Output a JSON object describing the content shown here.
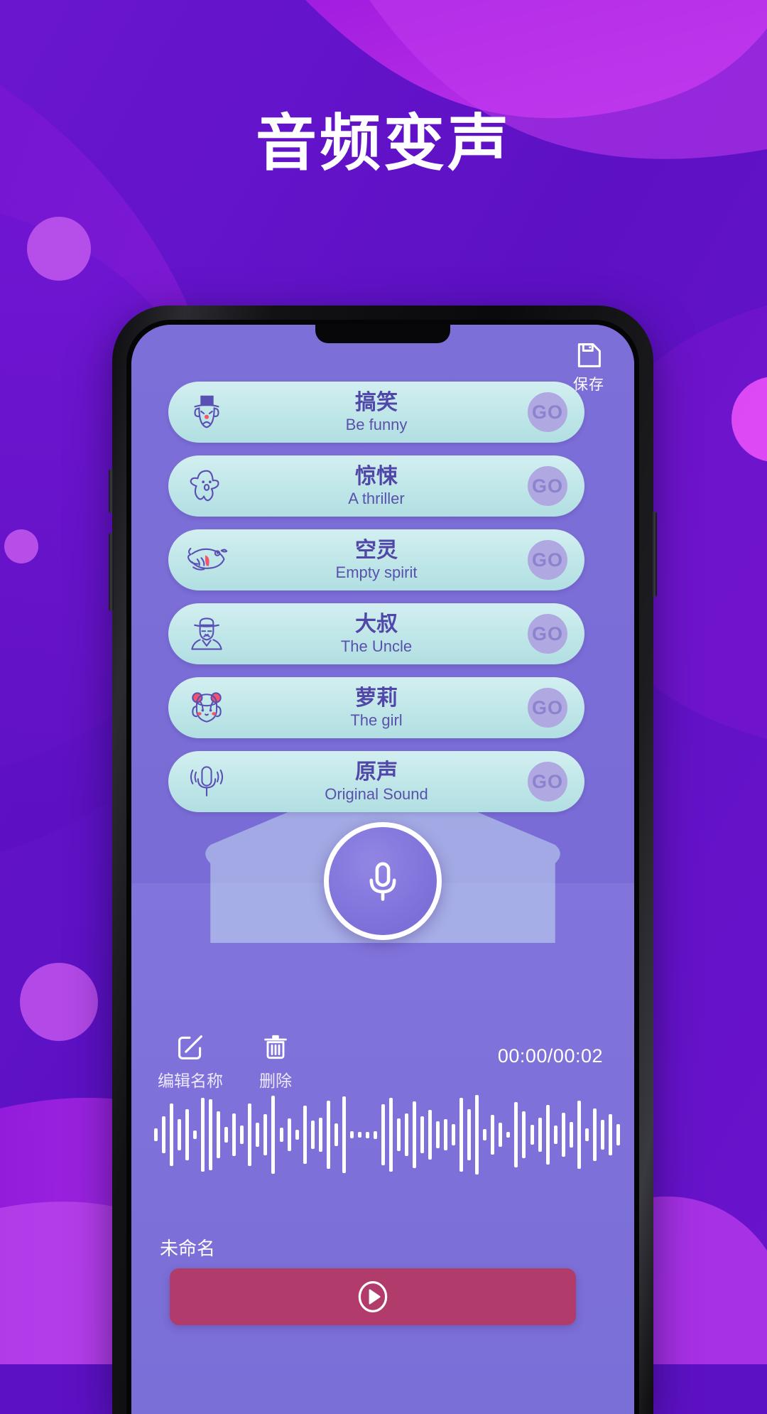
{
  "headline": "音频变声",
  "colors": {
    "bg_deep_purple": "#5d11c4",
    "bg_violet": "#7a10d8",
    "bg_magenta": "#b51fe0",
    "bg_pink": "#c94ae8",
    "screen_purple": "#7b6fd6",
    "row_mint": "#c5e9eb",
    "row_text": "#5147a8",
    "go_circle": "#b0a8e0",
    "play_bar": "#b13c6c",
    "accent_red": "#f45a6d"
  },
  "phone": {
    "save_button": {
      "label": "保存",
      "icon": "floppy-disk-icon"
    },
    "voice_list": [
      {
        "cn": "搞笑",
        "en": "Be funny",
        "go": "GO",
        "icon": "clown-face-icon"
      },
      {
        "cn": "惊悚",
        "en": "A thriller",
        "go": "GO",
        "icon": "ghost-icon"
      },
      {
        "cn": "空灵",
        "en": "Empty spirit",
        "go": "GO",
        "icon": "fish-icon"
      },
      {
        "cn": "大叔",
        "en": "The Uncle",
        "go": "GO",
        "icon": "man-with-hat-icon"
      },
      {
        "cn": "萝莉",
        "en": "The girl",
        "go": "GO",
        "icon": "girl-face-icon"
      },
      {
        "cn": "原声",
        "en": "Original Sound",
        "go": "GO",
        "icon": "microphone-icon"
      }
    ],
    "record_button": {
      "icon": "microphone-icon"
    },
    "tools": [
      {
        "label": "编辑名称",
        "icon": "edit-pencil-icon"
      },
      {
        "label": "删除",
        "icon": "trash-icon"
      }
    ],
    "timecode": "00:00/00:02",
    "track_name": "未命名",
    "play_button": {
      "icon": "play-circle-icon"
    },
    "waveform": {
      "bar_count": 60,
      "heights": [
        18,
        52,
        88,
        44,
        72,
        12,
        104,
        100,
        66,
        22,
        60,
        26,
        88,
        34,
        58,
        110,
        20,
        46,
        14,
        82,
        40,
        48,
        96,
        32,
        108,
        10,
        8,
        9,
        11,
        86,
        104,
        46,
        60,
        94,
        52,
        70,
        38,
        44,
        30,
        104,
        72,
        112,
        16,
        56,
        34,
        8,
        92,
        66,
        28,
        48,
        84,
        26,
        62,
        36,
        96,
        18,
        74,
        42,
        58,
        30
      ]
    }
  }
}
